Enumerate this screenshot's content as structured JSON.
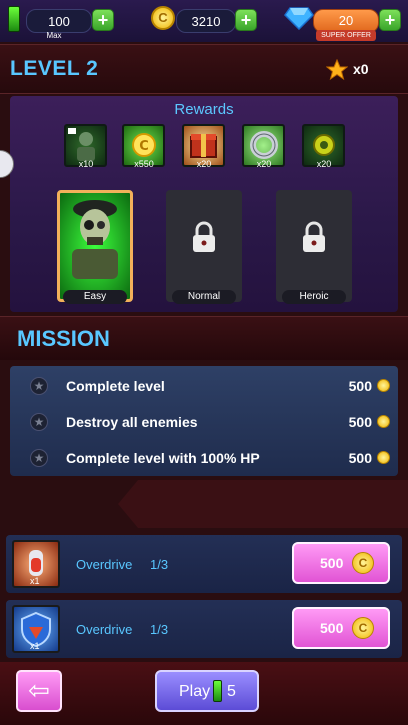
{
  "topbar": {
    "energy": {
      "value": "100",
      "sublabel": "Max"
    },
    "coins": {
      "value": "3210"
    },
    "gems": {
      "value": "20",
      "offer_label": "SUPER OFFER"
    }
  },
  "level": {
    "title": "LEVEL 2",
    "stars": "x0"
  },
  "rewards": {
    "title": "Rewards",
    "items": [
      {
        "icon": "soldier-reward-icon",
        "count": "x10"
      },
      {
        "icon": "coin-reward-icon",
        "count": "x550"
      },
      {
        "icon": "supply-crate-icon",
        "count": "x20"
      },
      {
        "icon": "ring-reward-icon",
        "count": "x20"
      },
      {
        "icon": "gear-reward-icon",
        "count": "x20"
      }
    ]
  },
  "difficulty": [
    {
      "label": "Easy",
      "locked": false
    },
    {
      "label": "Normal",
      "locked": true
    },
    {
      "label": "Heroic",
      "locked": true
    }
  ],
  "mission": {
    "title": "MISSION",
    "items": [
      {
        "text": "Complete level",
        "reward": "500"
      },
      {
        "text": "Destroy all enemies",
        "reward": "500"
      },
      {
        "text": "Complete level with 100% HP",
        "reward": "500"
      }
    ]
  },
  "upgrades": [
    {
      "icon": "overdrive-potion-icon",
      "qty": "x1",
      "name": "Overdrive",
      "progress": "1/3",
      "price": "500"
    },
    {
      "icon": "overdrive-shield-icon",
      "qty": "x1",
      "name": "Overdrive",
      "progress": "1/3",
      "price": "500"
    }
  ],
  "bottom": {
    "play_label": "Play",
    "play_cost": "5"
  },
  "colors": {
    "accent_blue": "#59c7ff",
    "button_pink": "#e154d4",
    "button_purple": "#5c4cd6",
    "plus_green": "#3aa52a"
  }
}
